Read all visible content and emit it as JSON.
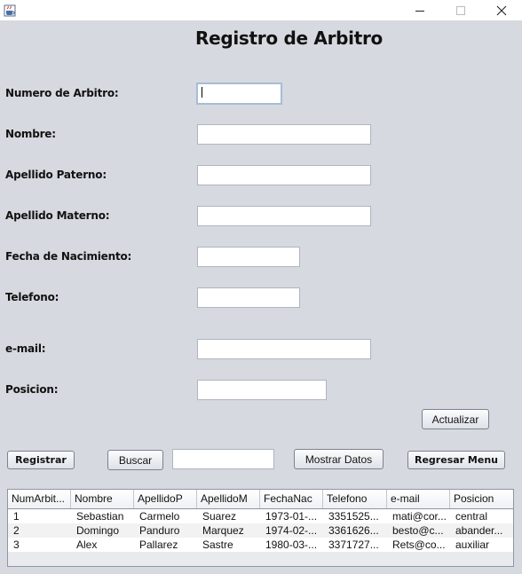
{
  "window": {
    "title": ""
  },
  "heading": "Registro de Arbitro",
  "form": {
    "numero_label": "Numero de Arbitro:",
    "nombre_label": "Nombre:",
    "apellido_paterno_label": "Apellido Paterno:",
    "apellido_materno_label": "Apellido Materno:",
    "fecha_label": "Fecha de Nacimiento:",
    "telefono_label": "Telefono:",
    "email_label": "e-mail:",
    "posicion_label": "Posicion:",
    "numero_value": "",
    "nombre_value": "",
    "apellido_paterno_value": "",
    "apellido_materno_value": "",
    "fecha_value": "",
    "telefono_value": "",
    "email_value": "",
    "posicion_value": ""
  },
  "buttons": {
    "actualizar": "Actualizar",
    "registrar": "Registrar",
    "buscar": "Buscar",
    "mostrar": "Mostrar Datos",
    "regresar": "Regresar Menu"
  },
  "search": {
    "value": ""
  },
  "table": {
    "columns": [
      "NumArbit...",
      "Nombre",
      "ApellidoP",
      "ApellidoM",
      "FechaNac",
      "Telefono",
      "e-mail",
      "Posicion"
    ],
    "rows": [
      [
        "1",
        "Sebastian",
        "Carmelo",
        "Suarez",
        "1973-01-...",
        "3351525...",
        "mati@cor...",
        "central"
      ],
      [
        "2",
        "Domingo",
        "Panduro",
        "Marquez",
        "1974-02-...",
        "3361626...",
        "besto@c...",
        "abander..."
      ],
      [
        "3",
        "Alex",
        "Pallarez",
        "Sastre",
        "1980-03-...",
        "3371727...",
        "Rets@co...",
        "auxiliar"
      ]
    ]
  },
  "icons": {
    "app": "java-cup-icon",
    "minimize": "minimize-icon",
    "maximize": "maximize-icon",
    "close": "close-icon"
  }
}
